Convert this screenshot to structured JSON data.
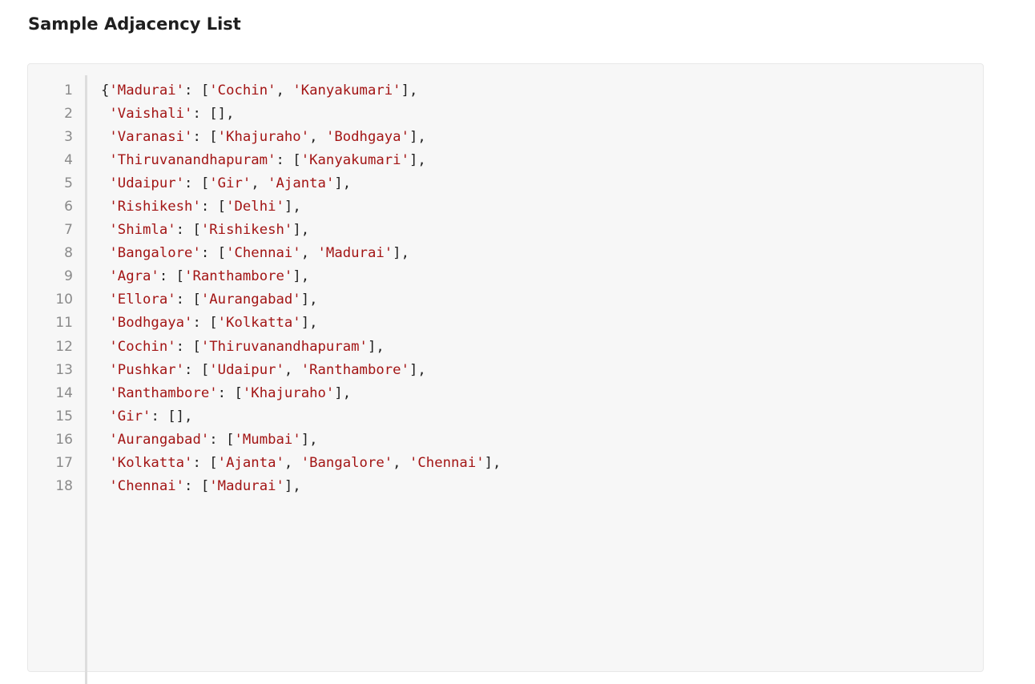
{
  "heading": "Sample Adjacency List",
  "code_lines": [
    {
      "n": "1",
      "t": "{'Madurai': ['Cochin', 'Kanyakumari'],"
    },
    {
      "n": "2",
      "t": " 'Vaishali': [],"
    },
    {
      "n": "3",
      "t": " 'Varanasi': ['Khajuraho', 'Bodhgaya'],"
    },
    {
      "n": "4",
      "t": " 'Thiruvanandhapuram': ['Kanyakumari'],"
    },
    {
      "n": "5",
      "t": " 'Udaipur': ['Gir', 'Ajanta'],"
    },
    {
      "n": "6",
      "t": " 'Rishikesh': ['Delhi'],"
    },
    {
      "n": "7",
      "t": " 'Shimla': ['Rishikesh'],"
    },
    {
      "n": "8",
      "t": " 'Bangalore': ['Chennai', 'Madurai'],"
    },
    {
      "n": "9",
      "t": " 'Agra': ['Ranthambore'],"
    },
    {
      "n": "10",
      "t": " 'Ellora': ['Aurangabad'],"
    },
    {
      "n": "11",
      "t": " 'Bodhgaya': ['Kolkatta'],"
    },
    {
      "n": "12",
      "t": " 'Cochin': ['Thiruvanandhapuram'],"
    },
    {
      "n": "13",
      "t": " 'Pushkar': ['Udaipur', 'Ranthambore'],"
    },
    {
      "n": "14",
      "t": " 'Ranthambore': ['Khajuraho'],"
    },
    {
      "n": "15",
      "t": " 'Gir': [],"
    },
    {
      "n": "16",
      "t": " 'Aurangabad': ['Mumbai'],"
    },
    {
      "n": "17",
      "t": " 'Kolkatta': ['Ajanta', 'Bangalore', 'Chennai'],"
    },
    {
      "n": "18",
      "t": " 'Chennai': ['Madurai'],"
    }
  ],
  "colors": {
    "string": "#a31515",
    "punctuation": "#222222",
    "line_number": "#8a8a8a",
    "code_background": "#f7f7f7"
  }
}
